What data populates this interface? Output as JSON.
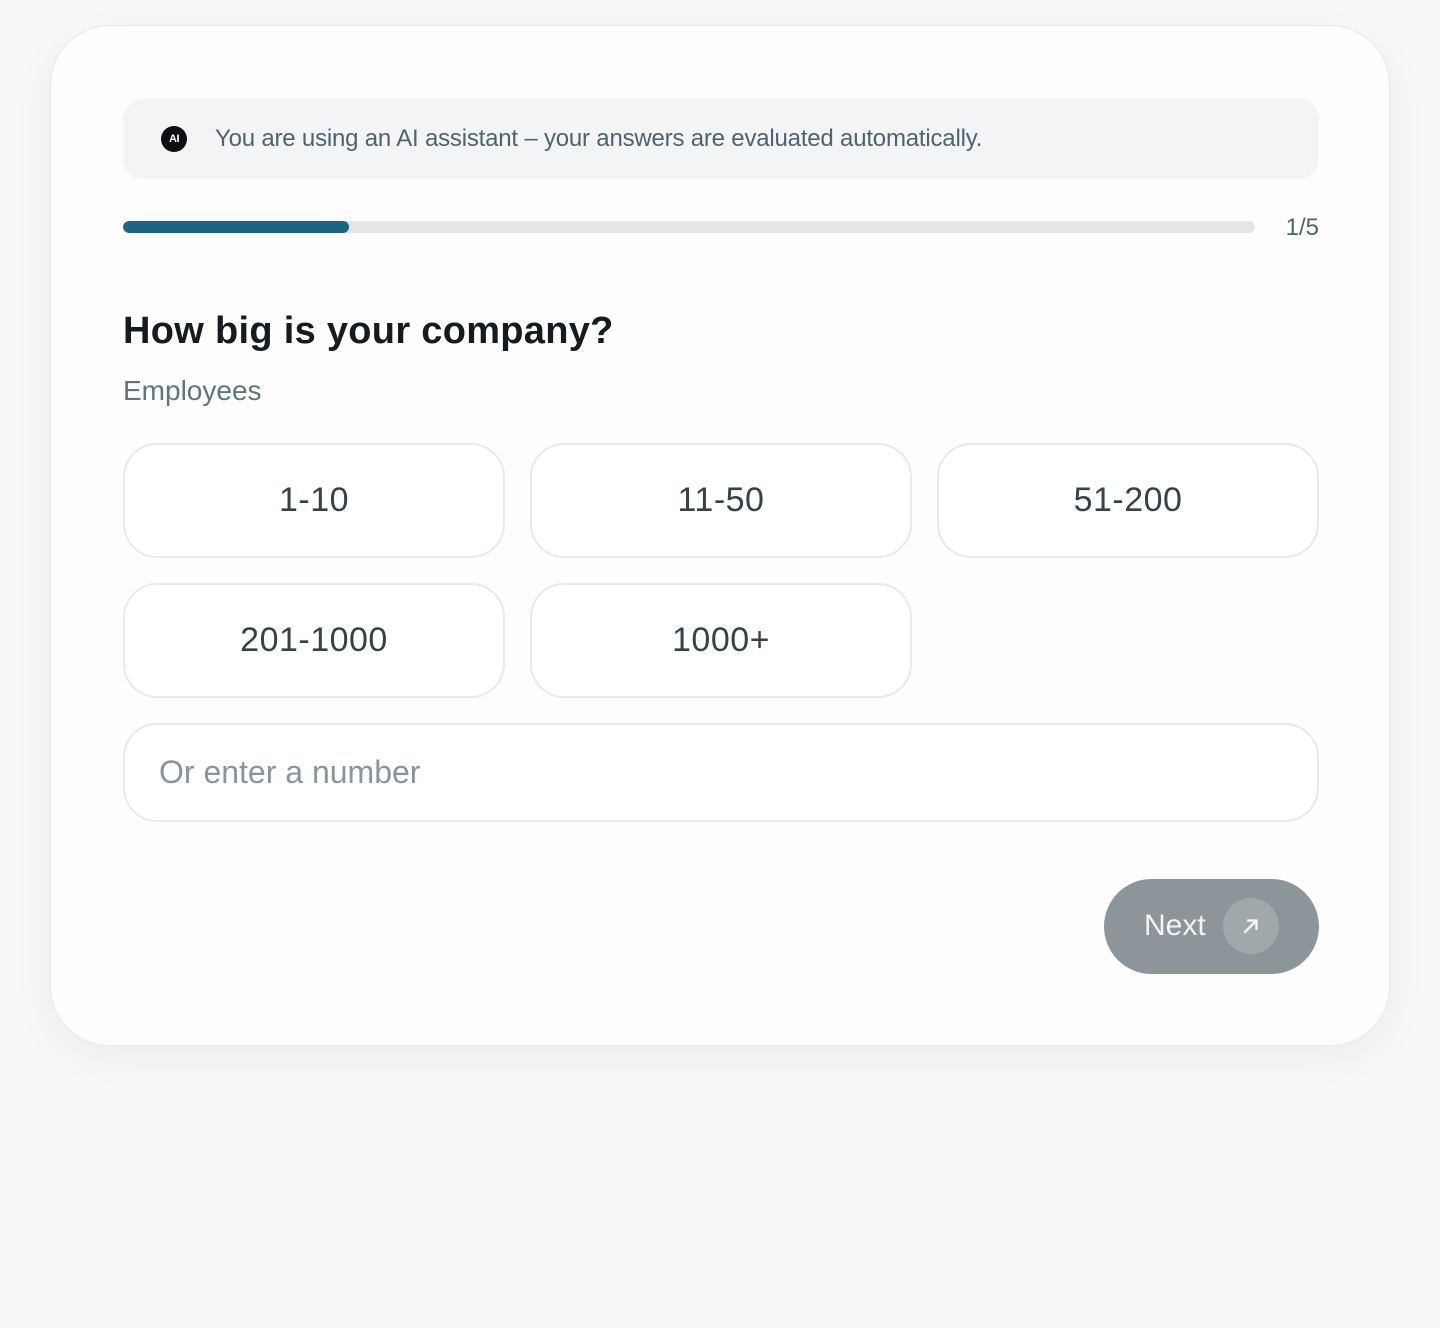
{
  "notice": {
    "badge": "AI",
    "text": "You are using an AI assistant – your answers are evaluated automatically."
  },
  "progress": {
    "fraction": 0.2,
    "label": "1/5"
  },
  "question": {
    "title": "How big is your company?",
    "subtitle": "Employees"
  },
  "options": [
    {
      "label": "1-10"
    },
    {
      "label": "11-50"
    },
    {
      "label": "51-200"
    },
    {
      "label": "201-1000"
    },
    {
      "label": "1000+"
    }
  ],
  "number_input": {
    "placeholder": "Or enter a number",
    "value": ""
  },
  "next_button": {
    "label": "Next",
    "icon": "arrow-up-right-icon"
  },
  "colors": {
    "accent": "#1c6580",
    "button_disabled": "#8c9599"
  }
}
